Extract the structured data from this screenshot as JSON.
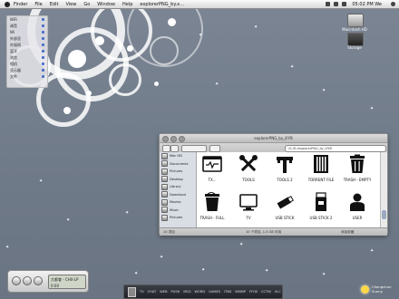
{
  "menubar": {
    "items": [
      "Finder",
      "File",
      "Edit",
      "View",
      "Go",
      "Window",
      "Help",
      "explorerPNG_by.x..."
    ],
    "clock": "05:02 PM We"
  },
  "left_panel": {
    "rows": [
      "WiFi",
      "调音",
      "Wi",
      "外部显",
      "外接网",
      "蓝牙",
      "浏览",
      "相机",
      "显示器",
      "文件"
    ]
  },
  "desktop_icons": [
    {
      "label": "Macintosh HD"
    },
    {
      "label": "Storage"
    }
  ],
  "finder": {
    "title": "explorerPNG_by_illYB",
    "path": "/S:/D:/explorerPNG_by_illYB",
    "sidebar": [
      "Mac HD",
      "Documents",
      "Pictures",
      "Desktop",
      "Library",
      "Download",
      "Movies",
      "Music",
      "Pictures"
    ],
    "items": [
      {
        "label": "TX...",
        "icon": "terminal-icon"
      },
      {
        "label": "TOOLS",
        "icon": "tools-icon"
      },
      {
        "label": "TOOLS 2",
        "icon": "wrench-icon"
      },
      {
        "label": "TORRENT FILE",
        "icon": "torrent-icon"
      },
      {
        "label": "TRASH - EMPTY",
        "icon": "trash-empty-icon"
      },
      {
        "label": "TRASH - FULL",
        "icon": "trash-full-icon"
      },
      {
        "label": "TV",
        "icon": "tv-icon"
      },
      {
        "label": "USB STICK",
        "icon": "usb-stick-icon"
      },
      {
        "label": "USB STICK 2",
        "icon": "usb-stick-2-icon"
      },
      {
        "label": "USER",
        "icon": "user-icon"
      }
    ],
    "status_left": "10 项目",
    "status_mid": "10 个项目, 1.5 GB 可用",
    "status_right": "添加收藏"
  },
  "player": {
    "track": "大都會 - CHX-LP",
    "time": "0:00"
  },
  "dock": {
    "items": [
      "TV",
      "CHAT",
      "WEB",
      "PUSH",
      "MSG",
      "WORD",
      "GAMES",
      "ITNS",
      "WMNP",
      "FFOX",
      "CCTW",
      "VLC"
    ]
  },
  "weather": {
    "city": "Changchun",
    "line2": "Sunny"
  },
  "colors": {
    "desktop": "#6f7a89",
    "menubar": "#e6e6e6",
    "sun": "#ffd84a"
  }
}
